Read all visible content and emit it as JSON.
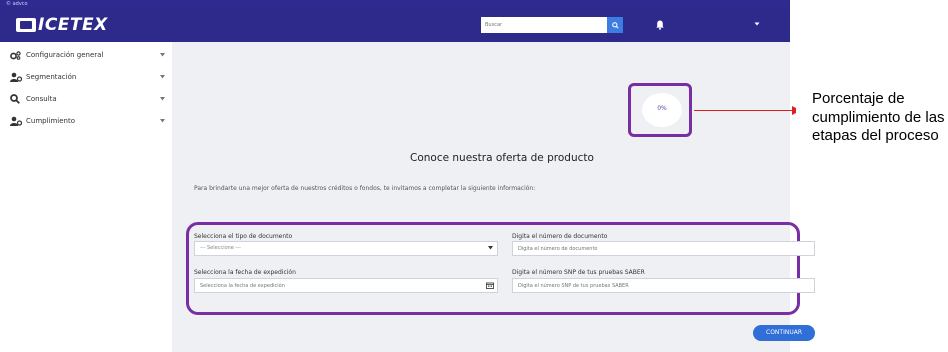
{
  "topbar": {
    "caption": "© advco"
  },
  "header": {
    "logo_text": "ICETEX",
    "search": {
      "placeholder": "Buscar"
    },
    "icons": [
      "search-icon",
      "bell-icon",
      "chevron-down-icon"
    ]
  },
  "sidebar": {
    "items": [
      {
        "label": "Configuración general",
        "icon": "gears-icon"
      },
      {
        "label": "Segmentación",
        "icon": "users-cog-icon"
      },
      {
        "label": "Consulta",
        "icon": "search-icon"
      },
      {
        "label": "Cumplimiento",
        "icon": "users-cog-icon"
      }
    ]
  },
  "progress": {
    "label": "0%",
    "value": 0
  },
  "annotation": {
    "text": "Porcentaje de cumplimiento de las etapas del proceso"
  },
  "main": {
    "heading": "Conoce nuestra oferta de producto",
    "intro": "Para brindarte una mejor oferta de nuestros créditos o fondos, te invitamos a completar la siguiente información:"
  },
  "form": {
    "doc_type": {
      "label": "Selecciona el tipo de documento",
      "value": "--- Seleccione ---"
    },
    "doc_number": {
      "label": "Digita el número de documento",
      "placeholder": "Digita el número de documento"
    },
    "issue_date": {
      "label": "Selecciona la fecha de expedición",
      "placeholder": "Selecciona la fecha de expedición"
    },
    "snp": {
      "label": "Digita el número SNP de tus pruebas SABER",
      "placeholder": "Digita el número SNP de tus pruebas SABER"
    }
  },
  "actions": {
    "continue_label": "CONTINUAR"
  },
  "colors": {
    "brand": "#2e2a8c",
    "accent": "#2f6fd6",
    "highlight": "#7a2ea3",
    "arrow": "#e02020"
  }
}
